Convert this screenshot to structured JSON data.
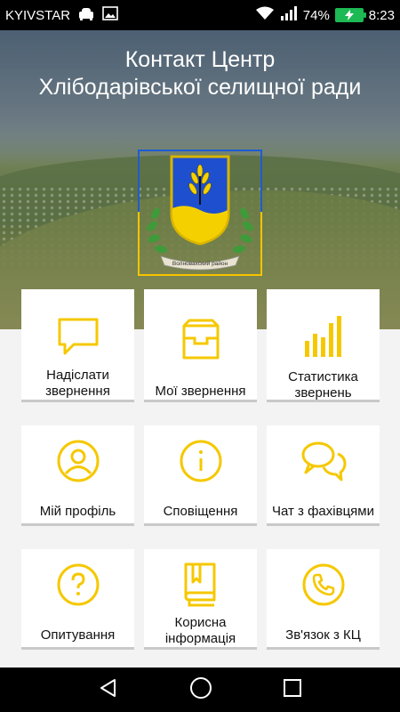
{
  "status_bar": {
    "carrier": "KYIVSTAR",
    "battery_percent": "74%",
    "time": "8:23"
  },
  "header": {
    "title_line1": "Контакт Центр",
    "title_line2": "Хлібодарівської селищної ради"
  },
  "emblem": {
    "ribbon_text": "Волноваxский район"
  },
  "colors": {
    "accent": "#f5c800",
    "text": "#111111",
    "tile_border": "#c9c9c9"
  },
  "tiles": [
    {
      "label": "Надіслати звернення",
      "icon": "chat-bubble-icon"
    },
    {
      "label": "Мої звернення",
      "icon": "inbox-tray-icon"
    },
    {
      "label": "Статистика звернень",
      "icon": "bar-chart-icon"
    },
    {
      "label": "Мій профіль",
      "icon": "user-profile-icon"
    },
    {
      "label": "Сповіщення",
      "icon": "info-icon"
    },
    {
      "label": "Чат з фахівцями",
      "icon": "chat-bubbles-icon"
    },
    {
      "label": "Опитування",
      "icon": "question-icon"
    },
    {
      "label": "Корисна інформація",
      "icon": "book-icon"
    },
    {
      "label": "Зв'язок з КЦ",
      "icon": "phone-icon"
    }
  ],
  "nav": {
    "back": "back-icon",
    "home": "home-icon",
    "recents": "recents-icon"
  }
}
